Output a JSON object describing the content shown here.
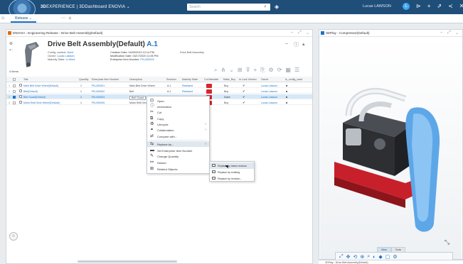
{
  "topbar": {
    "brand_bold": "3D",
    "brand_light": "EXPERIENCE | 3DDashboard",
    "brand_suffix": " ENOVIA ⌄",
    "search_placeholder": "Search",
    "user": "Lucas LAWSON",
    "colors": {
      "bar": "#1f4e79",
      "accent": "#3fa9f5"
    }
  },
  "tabs": [
    {
      "label": "Release ⌄"
    }
  ],
  "left_panel": {
    "title": "ENOVIA - Engineering Release - Drive Belt Assembly(Default)",
    "header": {
      "title": "Drive Belt Assembly(Default)",
      "title_suffix": " A.1",
      "fields": {
        "config_label": "Config. context:",
        "config_value": "None",
        "owner_label": "Owner:",
        "owner_value": "Lucas Lawson",
        "maturity_label": "Maturity State:",
        "maturity_value": "In Work",
        "created_label": "Creation Date:",
        "created_value": "04/03/2019 12:14 PM",
        "modified_label": "Modification Date:",
        "modified_value": "04/17/2020 11:55 PM",
        "ein_label": "Enterprise Item Number:",
        "ein_value": "PN-000003",
        "col3": "Drive Belt Assembly"
      }
    },
    "items_label": "4 items",
    "columns": [
      "Title",
      "Quantity",
      "Enterprise Item Number",
      "Description",
      "Revision",
      "Maturity State",
      "Col Mandate",
      "Make_Buy",
      "In Lock Version",
      "Owner",
      "Is_config_used"
    ],
    "rows": [
      {
        "num": "1",
        "title": "Main Belt Drive Wheel(Default)",
        "qty": "1",
        "ein": "PN-000001",
        "desc": "Main Belt Drive Wheel",
        "rev": "A.1",
        "state": "Released",
        "make": "Buy",
        "lock": "✔",
        "owner": "Lucas Lawson",
        "cfg": "■",
        "selected": false
      },
      {
        "num": "2",
        "title": "Belt(Default)",
        "qty": "1",
        "ein": "PN-000002",
        "desc": "Belt",
        "rev": "A.1",
        "state": "Released",
        "make": "Buy",
        "lock": "✔",
        "owner": "Lucas Lawson",
        "cfg": "■",
        "selected": false
      },
      {
        "num": "3",
        "title": "Belt Guard(Default)",
        "qty": "1",
        "ein": "PN-000004",
        "desc": "Belt Guard",
        "rev": "A.1",
        "state": "In Work",
        "make": "Make",
        "lock": "✔",
        "owner": "Lucas Lawson",
        "cfg": "■",
        "selected": true
      },
      {
        "num": "4",
        "title": "Motor Belt Drive Wheel(Default)",
        "qty": "1",
        "ein": "PN-000005",
        "desc": "Motor Belt Drive",
        "rev": "A.1",
        "state": "",
        "make": "Buy",
        "lock": "✔",
        "owner": "Lucas Lawson",
        "cfg": "■",
        "selected": false
      }
    ]
  },
  "context_menu": {
    "items": [
      "Open",
      "Information",
      "Cut",
      "Copy",
      "Lifecycle",
      "Collaboration",
      "Compare with...",
      "Replace by...",
      "Set Enterprise Item Number",
      "Change Quantity",
      "Detach",
      "Related Objects"
    ],
    "submenu": [
      "Replace by latest revision",
      "Replace by existing",
      "Replace by revision..."
    ]
  },
  "right_panel": {
    "title": "3DPlay - Compressor(Default)",
    "view_tabs": [
      "View",
      "Tools"
    ],
    "bottom_title": "3DPlay - Drive Belt Assembly(Default)"
  }
}
